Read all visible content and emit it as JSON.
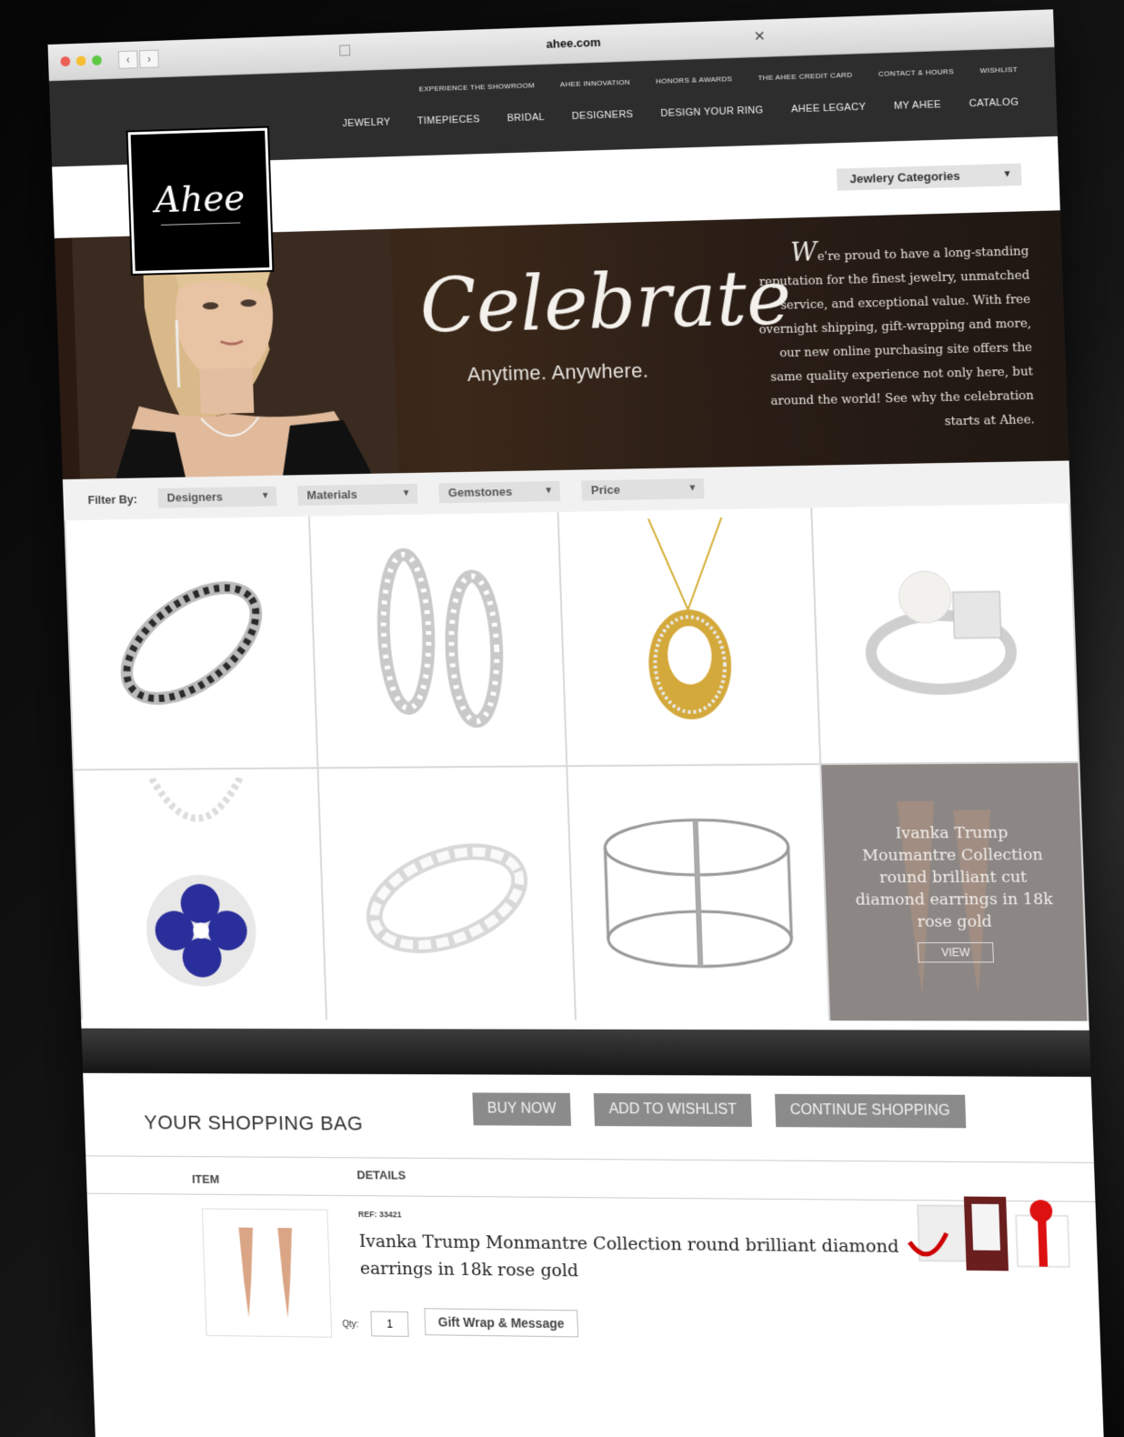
{
  "browser": {
    "url": "ahee.com"
  },
  "logo": {
    "text": "Ahee"
  },
  "top_nav": [
    "EXPERIENCE THE SHOWROOM",
    "AHEE INNOVATION",
    "HONORS & AWARDS",
    "THE AHEE CREDIT CARD",
    "CONTACT & HOURS",
    "WISHLIST"
  ],
  "main_nav": [
    "JEWELRY",
    "TIMEPIECES",
    "BRIDAL",
    "DESIGNERS",
    "DESIGN YOUR RING",
    "AHEE LEGACY",
    "MY AHEE",
    "CATALOG"
  ],
  "category_select": "Jewlery Categories",
  "hero": {
    "headline": "Celebrate",
    "subhead": "Anytime. Anywhere.",
    "blurb_initial": "W",
    "blurb": "e're proud to have a long-standing reputation for the finest jewelry, unmatched service, and exceptional value. With free overnight shipping, gift-wrapping and more, our new online purchasing site offers the same quality experience not only here, but around the world! See why the celebration starts at Ahee."
  },
  "filters": {
    "label": "Filter By:",
    "selects": [
      "Designers",
      "Materials",
      "Gemstones",
      "Price"
    ]
  },
  "products": [
    {
      "icon": "bangle-icon"
    },
    {
      "icon": "hoop-earrings-icon"
    },
    {
      "icon": "pendant-necklace-icon"
    },
    {
      "icon": "pearl-ring-icon"
    },
    {
      "icon": "sapphire-pendant-icon"
    },
    {
      "icon": "eternity-band-icon"
    },
    {
      "icon": "cuff-bracelet-icon"
    }
  ],
  "feature": {
    "text": "Ivanka Trump Moumantre Collection round brilliant cut diamond earrings in 18k rose gold",
    "button": "VIEW"
  },
  "bag": {
    "title": "YOUR SHOPPING BAG",
    "buttons": {
      "buy": "BUY NOW",
      "wishlist": "ADD TO WISHLIST",
      "continue": "CONTINUE SHOPPING"
    },
    "col_item": "ITEM",
    "col_details": "DETAILS",
    "ref": "REF: 33421",
    "product_name": "Ivanka Trump Monmantre Collection round brilliant diamond earrings in 18k rose gold",
    "qty_label": "Qty:",
    "qty": "1",
    "gift_button": "Gift Wrap & Message"
  },
  "colors": {
    "header": "#2d2d2d",
    "button": "#8b8b8b",
    "feature_bg": "#8c8785"
  }
}
